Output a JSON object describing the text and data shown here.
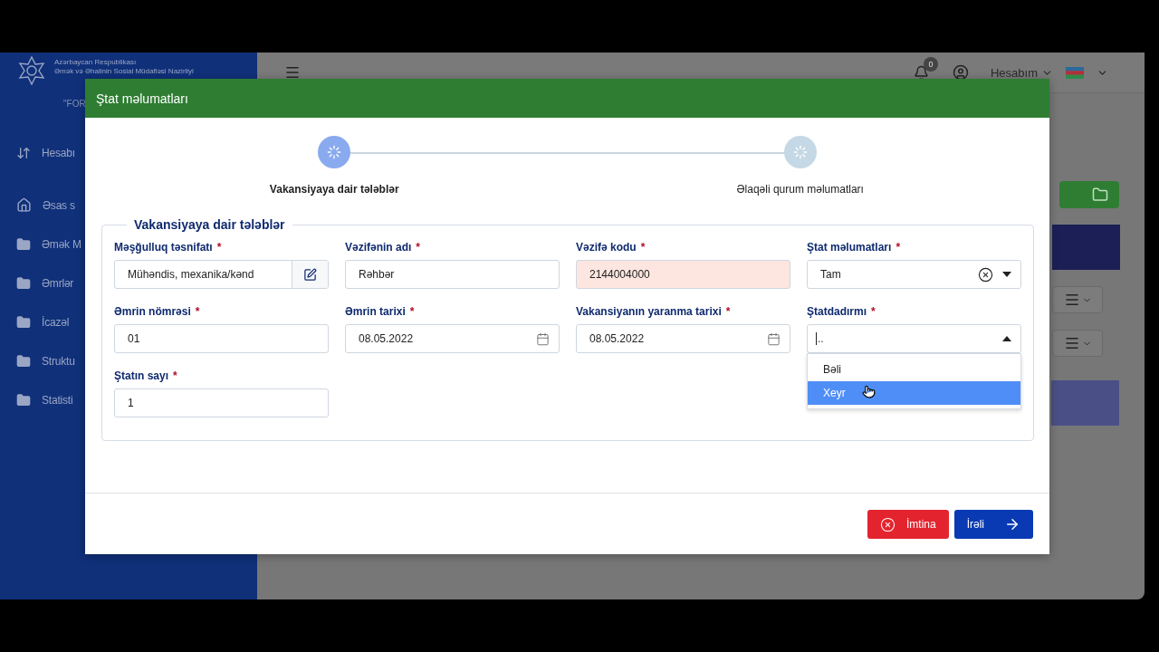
{
  "sidebar": {
    "org_line_1": "Azərbaycan Respublikası",
    "org_line_2": "Əmək və Əhalinin Sosial Müdafiəsi Nazirliyi",
    "tagline": "\"FOR",
    "items": [
      {
        "label": "Hesabı",
        "kind": "swap"
      },
      {
        "label": "Əsas s",
        "kind": "home"
      },
      {
        "label": "Əmək M",
        "kind": "folder"
      },
      {
        "label": "Əmrlər",
        "kind": "folder"
      },
      {
        "label": "İcazəl",
        "kind": "folder"
      },
      {
        "label": "Struktu",
        "kind": "folder"
      },
      {
        "label": "Statisti",
        "kind": "folder"
      }
    ]
  },
  "header": {
    "notifications": "0",
    "account": "Hesabım"
  },
  "modal": {
    "title": "Ştat məlumatları",
    "steps": [
      {
        "label": "Vakansiyaya dair tələblər",
        "active": true
      },
      {
        "label": "Əlaqəli qurum məlumatları",
        "active": false
      }
    ],
    "section": "Vakansiyaya dair tələblər",
    "fields": [
      {
        "label": "Məşğulluq təsnifatı",
        "required_mark": "*",
        "kind": "classifier",
        "value": "Mühəndis, mexanika/kənd",
        "highlighted": false
      },
      {
        "label": "Vəzifənin adı",
        "required_mark": "*",
        "kind": "text",
        "value": "Rəhbər",
        "highlighted": false
      },
      {
        "label": "Vəzifə kodu",
        "required_mark": "*",
        "kind": "text",
        "value": "2144004000",
        "highlighted": true
      },
      {
        "label": "Ştat məlumatları",
        "required_mark": "*",
        "kind": "select",
        "value": "Tam",
        "highlighted": false,
        "open": false
      },
      {
        "label": "Əmrin nömrəsi",
        "required_mark": "*",
        "kind": "text",
        "value": "01",
        "highlighted": false
      },
      {
        "label": "Əmrin tarixi",
        "required_mark": "*",
        "kind": "date",
        "value": "08.05.2022",
        "highlighted": false
      },
      {
        "label": "Vakansiyanın yaranma tarixi",
        "required_mark": "*",
        "kind": "date",
        "value": "08.05.2022",
        "highlighted": false
      },
      {
        "label": "Ştatdadırmı",
        "required_mark": "*",
        "kind": "combo",
        "placeholder": "..",
        "highlighted": false,
        "open": true,
        "options": [
          {
            "label": "Bəli",
            "selected": false
          },
          {
            "label": "Xeyr",
            "selected": true
          }
        ]
      },
      {
        "label": "Ştatın sayı",
        "required_mark": "*",
        "kind": "text",
        "value": "1",
        "highlighted": false
      }
    ],
    "buttons": [
      {
        "label": "İmtina",
        "kind": "cancel"
      },
      {
        "label": "İrəli",
        "kind": "next"
      }
    ]
  }
}
